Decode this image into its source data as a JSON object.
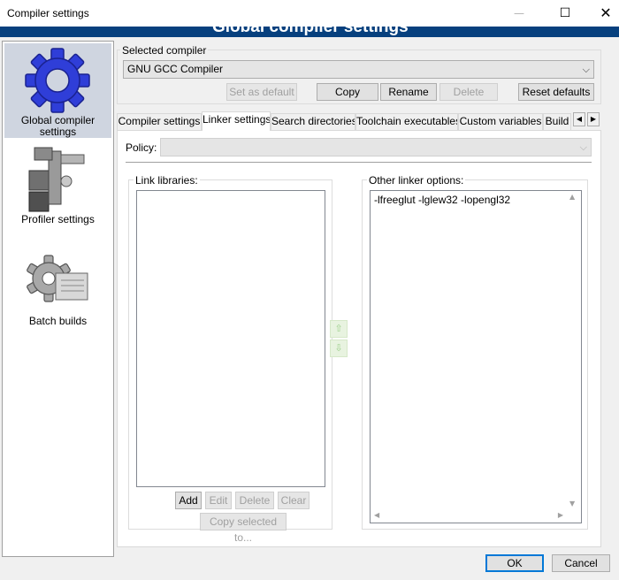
{
  "window": {
    "title": "Compiler settings",
    "minimize_glyph": "—",
    "maximize_glyph": "☐",
    "close_glyph": "✕"
  },
  "banner": {
    "title": "Global compiler settings"
  },
  "sidebar": {
    "items": [
      {
        "label_line1": "Global compiler",
        "label_line2": "settings",
        "icon": "gear-icon",
        "selected": true
      },
      {
        "label_line1": "Profiler settings",
        "icon": "profiler-icon",
        "selected": false
      },
      {
        "label_line1": "Batch builds",
        "icon": "batch-builds-icon",
        "selected": false
      }
    ]
  },
  "compiler_group": {
    "label": "Selected compiler",
    "selected_compiler": "GNU GCC Compiler",
    "buttons": {
      "set_default": "Set as default",
      "copy": "Copy",
      "rename": "Rename",
      "delete": "Delete",
      "reset_defaults": "Reset defaults"
    }
  },
  "tabs": [
    {
      "label": "Compiler settings",
      "active": false
    },
    {
      "label": "Linker settings",
      "active": true
    },
    {
      "label": "Search directories",
      "active": false
    },
    {
      "label": "Toolchain executables",
      "active": false
    },
    {
      "label": "Custom variables",
      "active": false
    },
    {
      "label": "Build",
      "active": false
    }
  ],
  "tab_scroll": {
    "left": "◀",
    "right": "▶"
  },
  "linker": {
    "policy_label": "Policy:",
    "policy_value": "",
    "link_libraries_label": "Link libraries:",
    "other_options_label": "Other linker options:",
    "other_options_value": "-lfreeglut -lglew32 -lopengl32",
    "buttons": {
      "add": "Add",
      "edit": "Edit",
      "delete": "Delete",
      "clear": "Clear",
      "copy_selected": "Copy selected to..."
    }
  },
  "footer": {
    "ok": "OK",
    "cancel": "Cancel"
  },
  "colors": {
    "banner": "#07407e",
    "selection": "#cfd5e0",
    "gear_blue": "#2f3ed8",
    "default_button_border": "#0078d7"
  }
}
